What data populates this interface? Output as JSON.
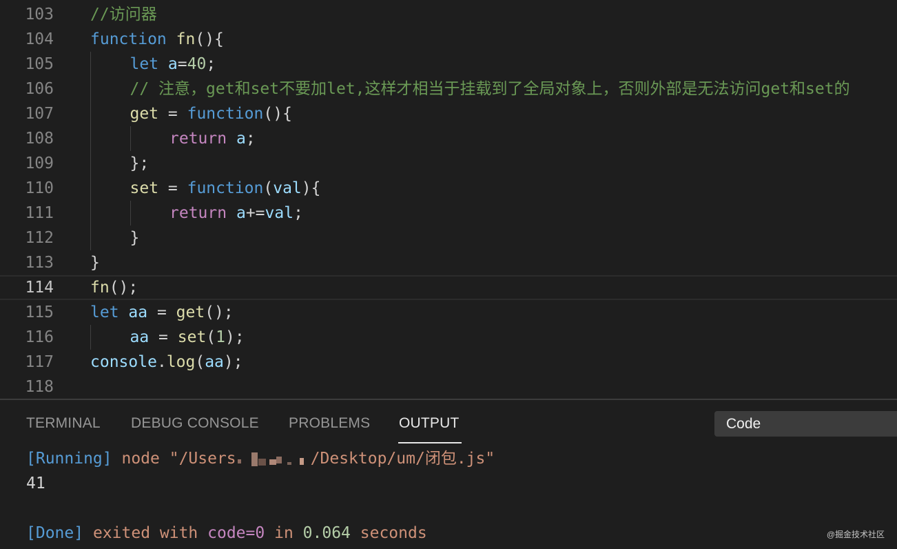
{
  "editor": {
    "current_line": "114",
    "lines": [
      {
        "num": "103",
        "indent": 0,
        "tokens": [
          [
            "//访问器",
            "comment"
          ]
        ]
      },
      {
        "num": "104",
        "indent": 0,
        "tokens": [
          [
            "function",
            "keyword"
          ],
          [
            " ",
            "punct"
          ],
          [
            "fn",
            "function"
          ],
          [
            "(){",
            "punct"
          ]
        ]
      },
      {
        "num": "105",
        "indent": 1,
        "tokens": [
          [
            "let",
            "keyword"
          ],
          [
            " ",
            "punct"
          ],
          [
            "a",
            "variable"
          ],
          [
            "=",
            "operator"
          ],
          [
            "40",
            "number"
          ],
          [
            ";",
            "punct"
          ]
        ]
      },
      {
        "num": "106",
        "indent": 1,
        "tokens": [
          [
            "// 注意，get和set不要加let,这样才相当于挂载到了全局对象上，否则外部是无法访问get和set的",
            "comment"
          ]
        ]
      },
      {
        "num": "107",
        "indent": 1,
        "tokens": [
          [
            "get",
            "function"
          ],
          [
            " = ",
            "operator"
          ],
          [
            "function",
            "keyword"
          ],
          [
            "(){",
            "punct"
          ]
        ]
      },
      {
        "num": "108",
        "indent": 2,
        "tokens": [
          [
            "return",
            "control"
          ],
          [
            " ",
            "punct"
          ],
          [
            "a",
            "variable"
          ],
          [
            ";",
            "punct"
          ]
        ]
      },
      {
        "num": "109",
        "indent": 1,
        "tokens": [
          [
            "};",
            "punct"
          ]
        ]
      },
      {
        "num": "110",
        "indent": 1,
        "tokens": [
          [
            "set",
            "function"
          ],
          [
            " = ",
            "operator"
          ],
          [
            "function",
            "keyword"
          ],
          [
            "(",
            "punct"
          ],
          [
            "val",
            "variable"
          ],
          [
            "){",
            "punct"
          ]
        ]
      },
      {
        "num": "111",
        "indent": 2,
        "tokens": [
          [
            "return",
            "control"
          ],
          [
            " ",
            "punct"
          ],
          [
            "a",
            "variable"
          ],
          [
            "+=",
            "operator"
          ],
          [
            "val",
            "variable"
          ],
          [
            ";",
            "punct"
          ]
        ]
      },
      {
        "num": "112",
        "indent": 1,
        "tokens": [
          [
            "}",
            "punct"
          ]
        ]
      },
      {
        "num": "113",
        "indent": 0,
        "tokens": [
          [
            "}",
            "punct"
          ]
        ]
      },
      {
        "num": "114",
        "indent": 0,
        "tokens": [
          [
            "fn",
            "function"
          ],
          [
            "();",
            "punct"
          ]
        ]
      },
      {
        "num": "115",
        "indent": 0,
        "tokens": [
          [
            "let",
            "keyword"
          ],
          [
            " ",
            "punct"
          ],
          [
            "aa",
            "variable"
          ],
          [
            " = ",
            "operator"
          ],
          [
            "get",
            "function"
          ],
          [
            "();",
            "punct"
          ]
        ]
      },
      {
        "num": "116",
        "indent": 1,
        "tokens": [
          [
            "aa",
            "variable"
          ],
          [
            " = ",
            "operator"
          ],
          [
            "set",
            "function"
          ],
          [
            "(",
            "punct"
          ],
          [
            "1",
            "number"
          ],
          [
            ");",
            "punct"
          ]
        ]
      },
      {
        "num": "117",
        "indent": 0,
        "tokens": [
          [
            "console",
            "variable"
          ],
          [
            ".",
            "punct"
          ],
          [
            "log",
            "function"
          ],
          [
            "(",
            "punct"
          ],
          [
            "aa",
            "variable"
          ],
          [
            ");",
            "punct"
          ]
        ]
      },
      {
        "num": "118",
        "indent": 0,
        "tokens": []
      }
    ]
  },
  "panel": {
    "tabs": [
      {
        "label": "TERMINAL",
        "active": false
      },
      {
        "label": "DEBUG CONSOLE",
        "active": false
      },
      {
        "label": "PROBLEMS",
        "active": false
      },
      {
        "label": "OUTPUT",
        "active": true
      }
    ],
    "output_channel": "Code",
    "output": {
      "running_tag": "[Running]",
      "command_prefix": "node \"/Users",
      "command_suffix": "/Desktop/um/闭包.js\"",
      "result": "41",
      "done_tag": "[Done]",
      "exited_text": "exited with",
      "code_text": "code=0",
      "in_text": "in",
      "seconds_value": "0.064",
      "seconds_text": "seconds"
    }
  },
  "watermark": "@掘金技术社区",
  "colors": {
    "background": "#1e1e1e",
    "comment": "#6a9955",
    "keyword": "#569cd6",
    "control": "#c586c0",
    "function": "#dcdcaa",
    "variable": "#9cdcfe",
    "number": "#b5cea8",
    "string": "#ce9178"
  }
}
